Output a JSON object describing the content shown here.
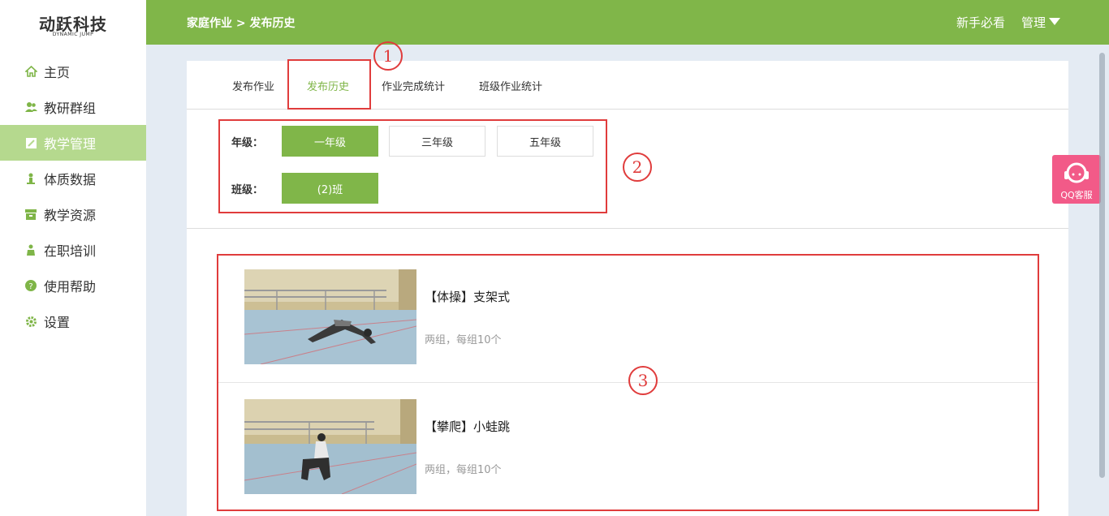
{
  "logo": {
    "main": "动跃科技",
    "sub": "DYNAMIC JUMP"
  },
  "sidebar": {
    "items": [
      {
        "label": "主页",
        "icon": "home-icon"
      },
      {
        "label": "教研群组",
        "icon": "users-icon"
      },
      {
        "label": "教学管理",
        "icon": "book-icon",
        "active": true
      },
      {
        "label": "体质数据",
        "icon": "person-icon"
      },
      {
        "label": "教学资源",
        "icon": "box-icon"
      },
      {
        "label": "在职培训",
        "icon": "trainer-icon"
      },
      {
        "label": "使用帮助",
        "icon": "help-icon"
      },
      {
        "label": "设置",
        "icon": "gear-icon"
      }
    ]
  },
  "header": {
    "breadcrumb": "家庭作业 > 发布历史",
    "guide_link": "新手必看",
    "manage_menu": "管理"
  },
  "tabs": [
    {
      "label": "发布作业"
    },
    {
      "label": "发布历史",
      "active": true
    },
    {
      "label": "作业完成统计"
    },
    {
      "label": "班级作业统计"
    }
  ],
  "filters": {
    "grade_label": "年级：",
    "grades": [
      "一年级",
      "三年级",
      "五年级"
    ],
    "selected_grade": "一年级",
    "class_label": "班级：",
    "classes": [
      "(2)班"
    ],
    "selected_class": "(2)班"
  },
  "items": [
    {
      "title": "【体操】支架式",
      "desc": "两组，每组10个"
    },
    {
      "title": "【攀爬】小蛙跳",
      "desc": "两组，每组10个"
    }
  ],
  "annotations": [
    "1",
    "2",
    "3"
  ],
  "qq_service": {
    "label": "QQ客服"
  },
  "colors": {
    "brand_green": "#80b649",
    "sidebar_active": "#b5d98e",
    "annotation_red": "#e03c3c",
    "qq_pink": "#f25a88"
  }
}
